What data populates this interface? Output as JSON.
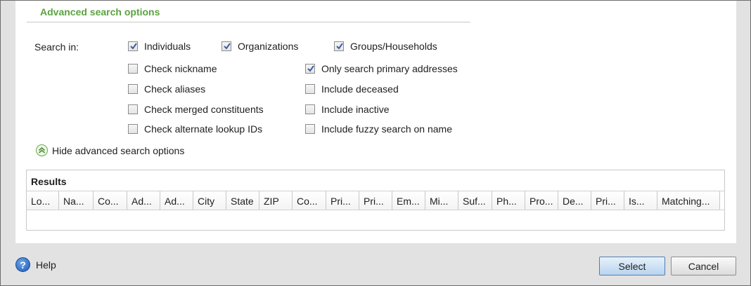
{
  "section": {
    "title": "Advanced search options"
  },
  "search_in": {
    "label": "Search in:",
    "options": [
      {
        "label": "Individuals",
        "checked": true
      },
      {
        "label": "Organizations",
        "checked": true
      },
      {
        "label": "Groups/Households",
        "checked": true
      }
    ]
  },
  "left_options": [
    {
      "label": "Check nickname",
      "checked": false
    },
    {
      "label": "Check aliases",
      "checked": false
    },
    {
      "label": "Check merged constituents",
      "checked": false
    },
    {
      "label": "Check alternate lookup IDs",
      "checked": false
    }
  ],
  "right_options": [
    {
      "label": "Only search primary addresses",
      "checked": true
    },
    {
      "label": "Include deceased",
      "checked": false
    },
    {
      "label": "Include inactive",
      "checked": false
    },
    {
      "label": "Include fuzzy search on name",
      "checked": false
    }
  ],
  "toggle": {
    "label": "Hide advanced search options",
    "icon": "chevron-double-up-icon"
  },
  "results": {
    "title": "Results",
    "columns": [
      "Lo...",
      "Na...",
      "Co...",
      "Ad...",
      "Ad...",
      "City",
      "State",
      "ZIP",
      "Co...",
      "Pri...",
      "Pri...",
      "Em...",
      "Mi...",
      "Suf...",
      "Ph...",
      "Pro...",
      "De...",
      "Pri...",
      "Is...",
      "Matching..."
    ]
  },
  "footer": {
    "help_label": "Help",
    "help_icon": "question-icon",
    "select_label": "Select",
    "cancel_label": "Cancel"
  },
  "colors": {
    "accent": "#5aa33f",
    "select_button": "#b9d4ee",
    "help_icon": "#1d58b5"
  }
}
